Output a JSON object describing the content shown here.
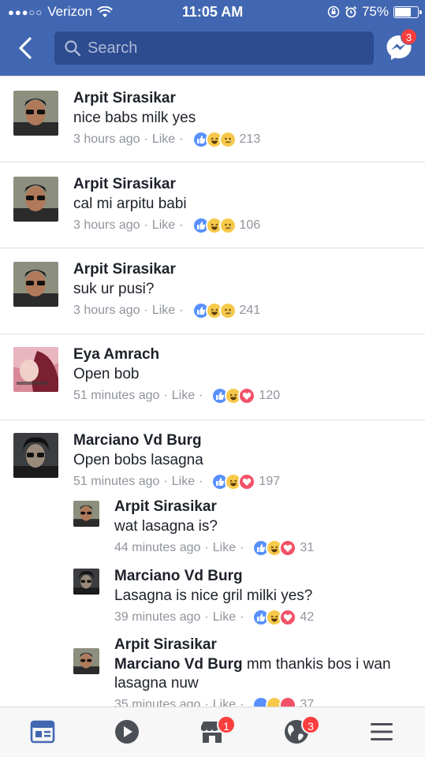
{
  "status_bar": {
    "carrier": "Verizon",
    "time": "11:05 AM",
    "battery": "75%",
    "battery_level": 0.75
  },
  "nav": {
    "search_placeholder": "Search",
    "messenger_badge": "3"
  },
  "colors": {
    "brand": "#4267b2",
    "like": "#5890ff",
    "love": "#f25268",
    "haha": "#f7c94b",
    "badge": "#fa3e3e"
  },
  "comments": [
    {
      "name": "Arpit Sirasikar",
      "text": "nice babs milk yes",
      "time": "3 hours ago",
      "like_label": "Like",
      "reactions": [
        "like-icon",
        "haha-icon",
        "sad-icon"
      ],
      "count": "213"
    },
    {
      "name": "Arpit Sirasikar",
      "text": "cal mi arpitu babi",
      "time": "3 hours ago",
      "like_label": "Like",
      "reactions": [
        "like-icon",
        "haha-icon",
        "sad-icon"
      ],
      "count": "106"
    },
    {
      "name": "Arpit Sirasikar",
      "text": "suk ur pusi?",
      "time": "3 hours ago",
      "like_label": "Like",
      "reactions": [
        "like-icon",
        "haha-icon",
        "sad-icon"
      ],
      "count": "241"
    },
    {
      "name": "Eya Amrach",
      "text": "Open bob",
      "time": "51 minutes ago",
      "like_label": "Like",
      "reactions": [
        "like-icon",
        "haha-icon",
        "love-icon"
      ],
      "count": "120"
    },
    {
      "name": "Marciano Vd Burg",
      "text": "Open bobs lasagna",
      "time": "51 minutes ago",
      "like_label": "Like",
      "reactions": [
        "like-icon",
        "haha-icon",
        "love-icon"
      ],
      "count": "197"
    }
  ],
  "replies": [
    {
      "name": "Arpit Sirasikar",
      "text": "wat lasagna is?",
      "time": "44 minutes ago",
      "like_label": "Like",
      "reactions": [
        "like-icon",
        "haha-icon",
        "love-icon"
      ],
      "count": "31"
    },
    {
      "name": "Marciano Vd Burg",
      "text": "Lasagna is nice gril milki yes?",
      "time": "39 minutes ago",
      "like_label": "Like",
      "reactions": [
        "like-icon",
        "haha-icon",
        "love-icon"
      ],
      "count": "42"
    },
    {
      "name": "Arpit Sirasikar",
      "mention": "Marciano Vd Burg",
      "text_line1": "mm thankis bos i wan",
      "text_line2": "lasagna nuw",
      "time": "35 minutes ago",
      "like_label": "Like",
      "count": "37"
    }
  ],
  "tabbar": {
    "marketplace_badge": "1",
    "notifications_badge": "3"
  }
}
